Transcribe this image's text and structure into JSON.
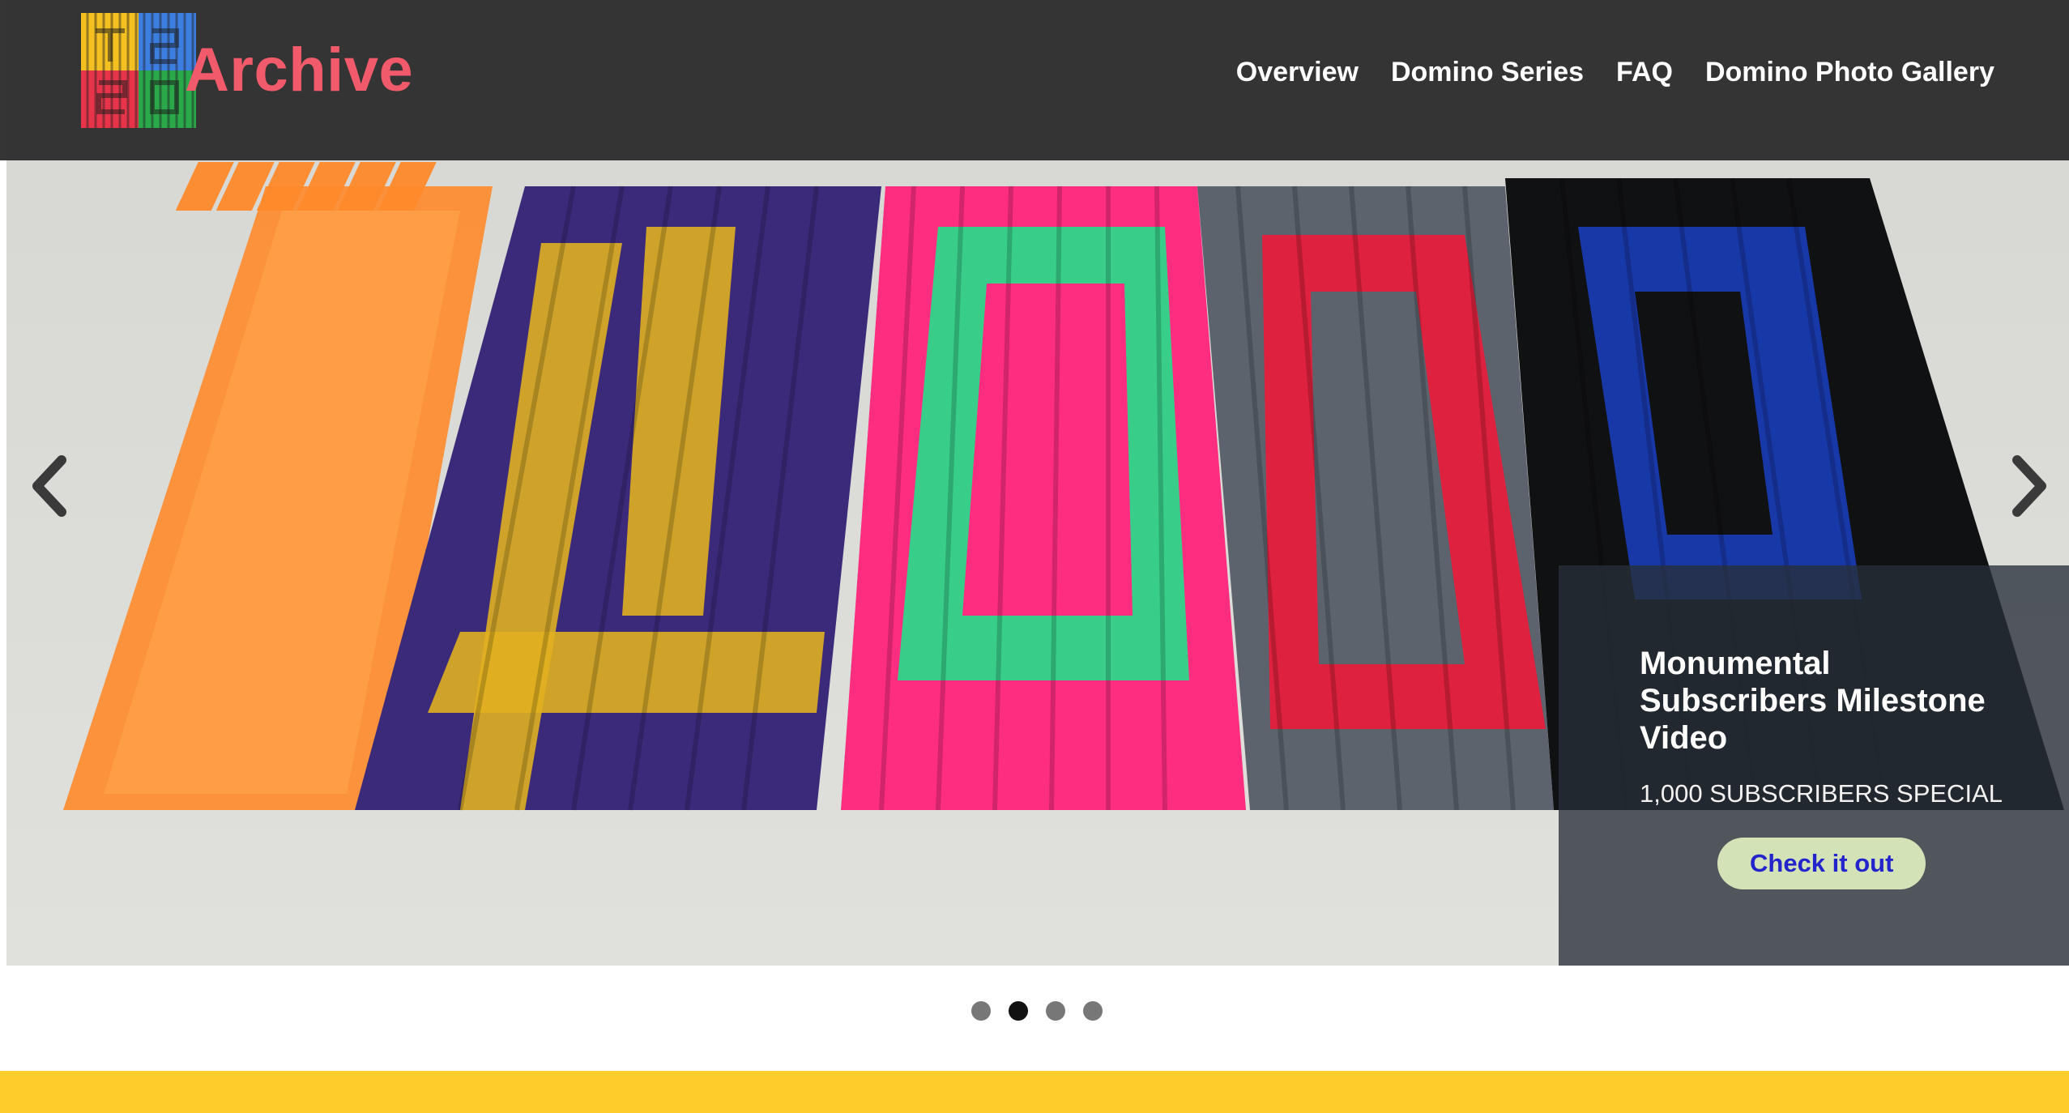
{
  "brand": {
    "name": "Archive",
    "logo_icon": "domino-grid-logo-icon"
  },
  "nav": {
    "items": [
      {
        "label": "Overview"
      },
      {
        "label": "Domino Series"
      },
      {
        "label": "FAQ"
      },
      {
        "label": "Domino Photo Gallery"
      }
    ]
  },
  "carousel": {
    "prev_icon": "chevron-left-icon",
    "next_icon": "chevron-right-icon",
    "slide_count": 4,
    "active_slide": 2,
    "caption": {
      "title": "Monumental Subscribers Milestone Video",
      "subtitle": "1,000 SUBSCRIBERS SPECIAL",
      "button_label": "Check it out"
    }
  },
  "colors": {
    "brand_text": "#f05a6a",
    "navbar_bg": "#2d2d2d",
    "cta_bg": "#d4e2b8",
    "cta_text": "#2424cc",
    "footer_band": "#ffcd2b",
    "indicator_active": "#111111",
    "indicator_inactive": "#777777"
  }
}
